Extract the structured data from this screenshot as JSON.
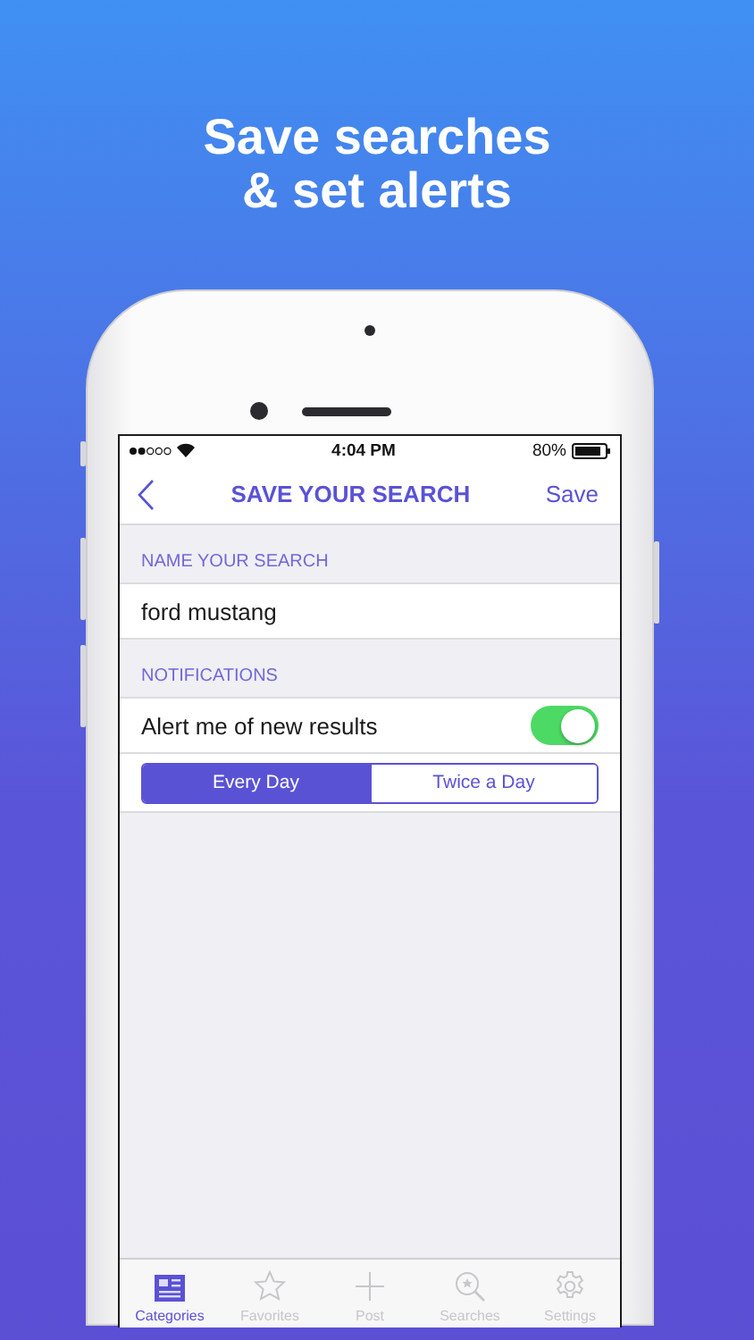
{
  "headline": [
    "Save searches",
    "& set alerts"
  ],
  "status_bar": {
    "time": "4:04 PM",
    "battery": "80%"
  },
  "nav_bar": {
    "title": "SAVE YOUR SEARCH",
    "action": "Save"
  },
  "sections": [
    {
      "header": "NAME YOUR SEARCH",
      "rows": [
        {
          "kind": "text",
          "value": "ford mustang"
        }
      ]
    },
    {
      "header": "NOTIFICATIONS",
      "rows": [
        {
          "kind": "switch",
          "label": "Alert me of new results",
          "on": true
        },
        {
          "kind": "segmented",
          "options": [
            {
              "label": "Every Day",
              "selected": true
            },
            {
              "label": "Twice a Day",
              "selected": false
            }
          ]
        }
      ]
    }
  ],
  "tab_bar": [
    {
      "label": "Categories",
      "selected": true
    },
    {
      "label": "Favorites",
      "selected": false
    },
    {
      "label": "Post",
      "selected": false
    },
    {
      "label": "Searches",
      "selected": false
    },
    {
      "label": "Settings",
      "selected": false
    }
  ]
}
